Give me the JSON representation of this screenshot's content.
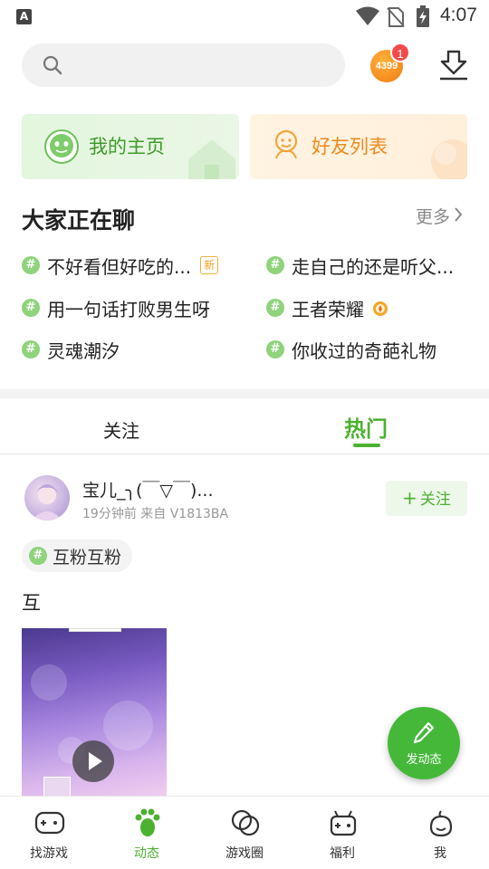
{
  "status_bar": {
    "time": "4:07",
    "icons": [
      "keyboard-a-icon",
      "wifi-icon",
      "no-sim-icon",
      "battery-charging-icon"
    ],
    "keyboard_letter": "A"
  },
  "header": {
    "search_placeholder": "",
    "brand_badge_text": "4399",
    "notification_count": "1",
    "icons": [
      "search-icon",
      "4399-logo-icon",
      "download-icon"
    ]
  },
  "quick_cards": [
    {
      "label": "我的主页",
      "icon": "face-icon",
      "color": "#3e9a2a"
    },
    {
      "label": "好友列表",
      "icon": "friends-icon",
      "color": "#f08a1c"
    }
  ],
  "chatting": {
    "title": "大家正在聊",
    "more": "更多",
    "topics": [
      {
        "text": "不好看但好吃的...",
        "badge": "新"
      },
      {
        "text": "走自己的还是听父..."
      },
      {
        "text": "用一句话打败男生呀"
      },
      {
        "text": "王者荣耀",
        "icon": "hot-icon"
      },
      {
        "text": "灵魂潮汐"
      },
      {
        "text": "你收过的奇葩礼物"
      }
    ]
  },
  "tabs": [
    {
      "label": "关注",
      "active": false
    },
    {
      "label": "热门",
      "active": true
    }
  ],
  "post": {
    "username": "宝儿_╮(￣▽￣)...",
    "meta": "19分钟前  来自 V1813BA",
    "follow_label": "关注",
    "topic": "互粉互粉",
    "content": "互",
    "media": "video"
  },
  "fab": {
    "label": "发动态",
    "icon": "pencil-icon"
  },
  "bottom_nav": [
    {
      "label": "找游戏",
      "icon": "gamepad-icon",
      "active": false
    },
    {
      "label": "动态",
      "icon": "paw-icon",
      "active": true
    },
    {
      "label": "游戏圈",
      "icon": "circles-icon",
      "active": false
    },
    {
      "label": "福利",
      "icon": "gift-gamepad-icon",
      "active": false
    },
    {
      "label": "我",
      "icon": "profile-icon",
      "active": false
    }
  ],
  "colors": {
    "accent": "#4cb130",
    "orange": "#f08a1c",
    "badge": "#f24b4b"
  }
}
